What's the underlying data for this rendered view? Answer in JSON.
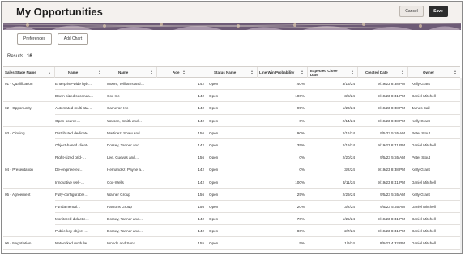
{
  "header": {
    "title": "My Opportunities",
    "cancel_label": "Cancel",
    "save_label": "Save"
  },
  "toolbar": {
    "preferences_label": "Preferences",
    "add_chart_label": "Add Chart"
  },
  "results": {
    "label": "Results",
    "count": "16"
  },
  "table": {
    "columns": [
      "Sales Stage Name",
      "Name",
      "Name",
      "Age",
      "Status Name",
      "Line Win Probability",
      "Expected Close Date",
      "Created Date",
      "Owner"
    ],
    "rows": [
      {
        "stage": "01 - Qualification",
        "opp": "Enterprise-wide hyb…",
        "account": "Moore, Williams and…",
        "age": "142",
        "status": "Open",
        "prob": "40%",
        "close": "3/15/24",
        "created": "9/19/23 8:38 PM",
        "owner": "Kelly Grant"
      },
      {
        "stage": "",
        "opp": "Down-sized seconda…",
        "account": "Cox Inc",
        "age": "142",
        "status": "Open",
        "prob": "100%",
        "close": "3/8/24",
        "created": "9/19/23 8:41 PM",
        "owner": "Daniel Mitchell"
      },
      {
        "stage": "02 - Opportunity",
        "opp": "Automated multi-sta…",
        "account": "Cameron Inc",
        "age": "142",
        "status": "Open",
        "prob": "95%",
        "close": "1/20/24",
        "created": "9/19/23 8:38 PM",
        "owner": "James Ball"
      },
      {
        "stage": "",
        "opp": "Open-source…",
        "account": "Watson, Smith and…",
        "age": "142",
        "status": "Open",
        "prob": "0%",
        "close": "2/14/24",
        "created": "9/19/23 8:38 PM",
        "owner": "Kelly Grant"
      },
      {
        "stage": "03 - Closing",
        "opp": "Distributed dedicate…",
        "account": "Martinez, Shaw and…",
        "age": "156",
        "status": "Open",
        "prob": "90%",
        "close": "2/16/24",
        "created": "9/5/23 5:55 AM",
        "owner": "Peter Stout"
      },
      {
        "stage": "",
        "opp": "Object-based client-…",
        "account": "Dorsey, Tanner and…",
        "age": "142",
        "status": "Open",
        "prob": "35%",
        "close": "2/19/24",
        "created": "9/19/23 8:41 PM",
        "owner": "Daniel Mitchell"
      },
      {
        "stage": "",
        "opp": "Right-sized grid-…",
        "account": "Lee, Cuevas and…",
        "age": "156",
        "status": "Open",
        "prob": "0%",
        "close": "2/20/24",
        "created": "9/5/23 5:55 AM",
        "owner": "Peter Stout"
      },
      {
        "stage": "04 - Presentation",
        "opp": "De-engineered…",
        "account": "Hernandez, Payne a…",
        "age": "142",
        "status": "Open",
        "prob": "0%",
        "close": "3/2/24",
        "created": "9/19/23 8:38 PM",
        "owner": "Kelly Grant"
      },
      {
        "stage": "",
        "opp": "Innovative well-…",
        "account": "Cox-Wells",
        "age": "142",
        "status": "Open",
        "prob": "100%",
        "close": "3/11/24",
        "created": "9/19/23 8:41 PM",
        "owner": "Daniel Mitchell"
      },
      {
        "stage": "05 - Agreement",
        "opp": "Fully-configurable…",
        "account": "Warner Group",
        "age": "156",
        "status": "Open",
        "prob": "25%",
        "close": "2/29/24",
        "created": "9/5/23 5:55 AM",
        "owner": "Kelly Grant"
      },
      {
        "stage": "",
        "opp": "Fundamental…",
        "account": "Parsons Group",
        "age": "156",
        "status": "Open",
        "prob": "20%",
        "close": "3/2/24",
        "created": "9/5/23 5:55 AM",
        "owner": "Daniel Mitchell"
      },
      {
        "stage": "",
        "opp": "Monitored didactic…",
        "account": "Dorsey, Tanner and…",
        "age": "142",
        "status": "Open",
        "prob": "70%",
        "close": "1/25/24",
        "created": "9/19/23 8:41 PM",
        "owner": "Daniel Mitchell"
      },
      {
        "stage": "",
        "opp": "Public-key object-…",
        "account": "Dorsey, Tanner and…",
        "age": "142",
        "status": "Open",
        "prob": "80%",
        "close": "2/7/24",
        "created": "9/19/23 8:41 PM",
        "owner": "Daniel Mitchell"
      },
      {
        "stage": "06 - Negotiation",
        "opp": "Networked modular…",
        "account": "Woods and Sons",
        "age": "155",
        "status": "Open",
        "prob": "5%",
        "close": "1/9/24",
        "created": "9/6/23 4:32 PM",
        "owner": "Daniel Mitchell"
      }
    ]
  },
  "icons": {
    "sort": "sort-icon"
  },
  "colors": {
    "header_bg": "#f4f1ee",
    "save_bg": "#2d2d2d",
    "banner": "#6d5b76"
  }
}
